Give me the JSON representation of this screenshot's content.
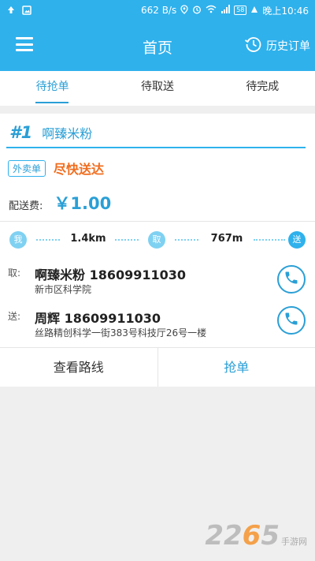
{
  "status_bar": {
    "net_speed": "662 B/s",
    "time": "晚上10:46",
    "battery": "58"
  },
  "app_bar": {
    "title": "首页",
    "history_label": "历史订单",
    "menu_icon": "menu-icon",
    "history_icon": "history-clock-icon"
  },
  "tabs": [
    {
      "label": "待抢单",
      "active": true
    },
    {
      "label": "待取送",
      "active": false
    },
    {
      "label": "待完成",
      "active": false
    }
  ],
  "order": {
    "number": "#1",
    "shop_title": "啊臻米粉",
    "type_tag": "外卖单",
    "urgency": "尽快送达",
    "fee_label": "配送费:",
    "fee_value": "￥1.00",
    "markers": {
      "me": "我",
      "pickup": "取",
      "deliver": "送"
    },
    "dist_to_pickup": "1.4km",
    "dist_to_dest": "767m",
    "pickup": {
      "role": "取:",
      "name_phone": "啊臻米粉 18609911030",
      "address": "新市区科学院"
    },
    "dropoff": {
      "role": "送:",
      "name_phone": "周辉 18609911030",
      "address": "丝路精创科学一街383号科技厅26号一楼"
    },
    "actions": {
      "view_route": "查看路线",
      "grab": "抢单"
    }
  },
  "watermark": {
    "number_part1": "22",
    "number_part2": "6",
    "number_part3": "5",
    "sub": "手游网"
  },
  "colors": {
    "primary": "#2fb1ec",
    "accent_text": "#2a9fd6",
    "urgent": "#f06d1f"
  }
}
